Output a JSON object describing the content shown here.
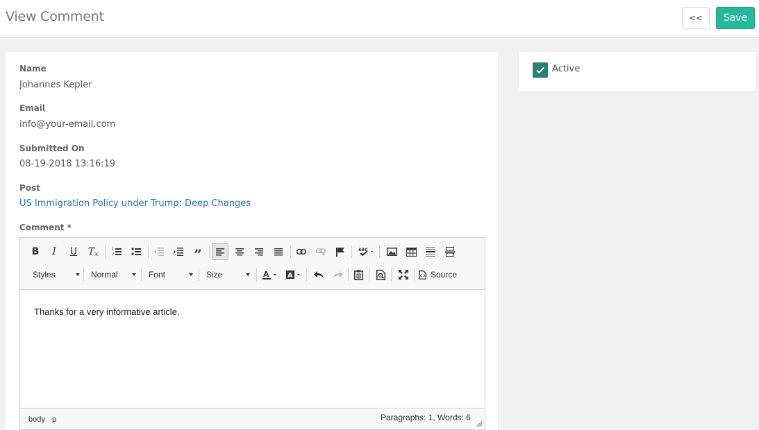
{
  "header": {
    "title": "View Comment",
    "back_label": "<<",
    "save_label": "Save"
  },
  "fields": {
    "name_label": "Name",
    "name_value": "Johannes Kepler",
    "email_label": "Email",
    "email_value": "info@your-email.com",
    "submitted_label": "Submitted On",
    "submitted_value": "08-19-2018 13:16:19",
    "post_label": "Post",
    "post_value": "US Immigration Policy under Trump: Deep Changes",
    "comment_label": "Comment *"
  },
  "editor": {
    "toolbar_row1": [
      "bold-icon",
      "italic-icon",
      "underline-icon",
      "remove-format-icon",
      "numbered-list-icon",
      "bulleted-list-icon",
      "decrease-indent-icon",
      "increase-indent-icon",
      "blockquote-icon",
      "align-left-icon",
      "align-center-icon",
      "align-right-icon",
      "justify-icon",
      "link-icon",
      "unlink-icon",
      "anchor-icon",
      "spellcheck-icon",
      "image-icon",
      "table-icon",
      "horizontal-line-icon",
      "page-break-icon"
    ],
    "styles_label": "Styles",
    "format_label": "Normal",
    "font_label": "Font",
    "size_label": "Size",
    "source_label": "Source",
    "content": "Thanks for a very informative article.",
    "path": [
      "body",
      "p"
    ],
    "word_count": "Paragraphs: 1, Words: 6"
  },
  "sidebar": {
    "active_label": "Active",
    "active_checked": true
  },
  "colors": {
    "save": "#26b99a",
    "checkbox": "#2a7f74",
    "link": "#2a76b9"
  }
}
